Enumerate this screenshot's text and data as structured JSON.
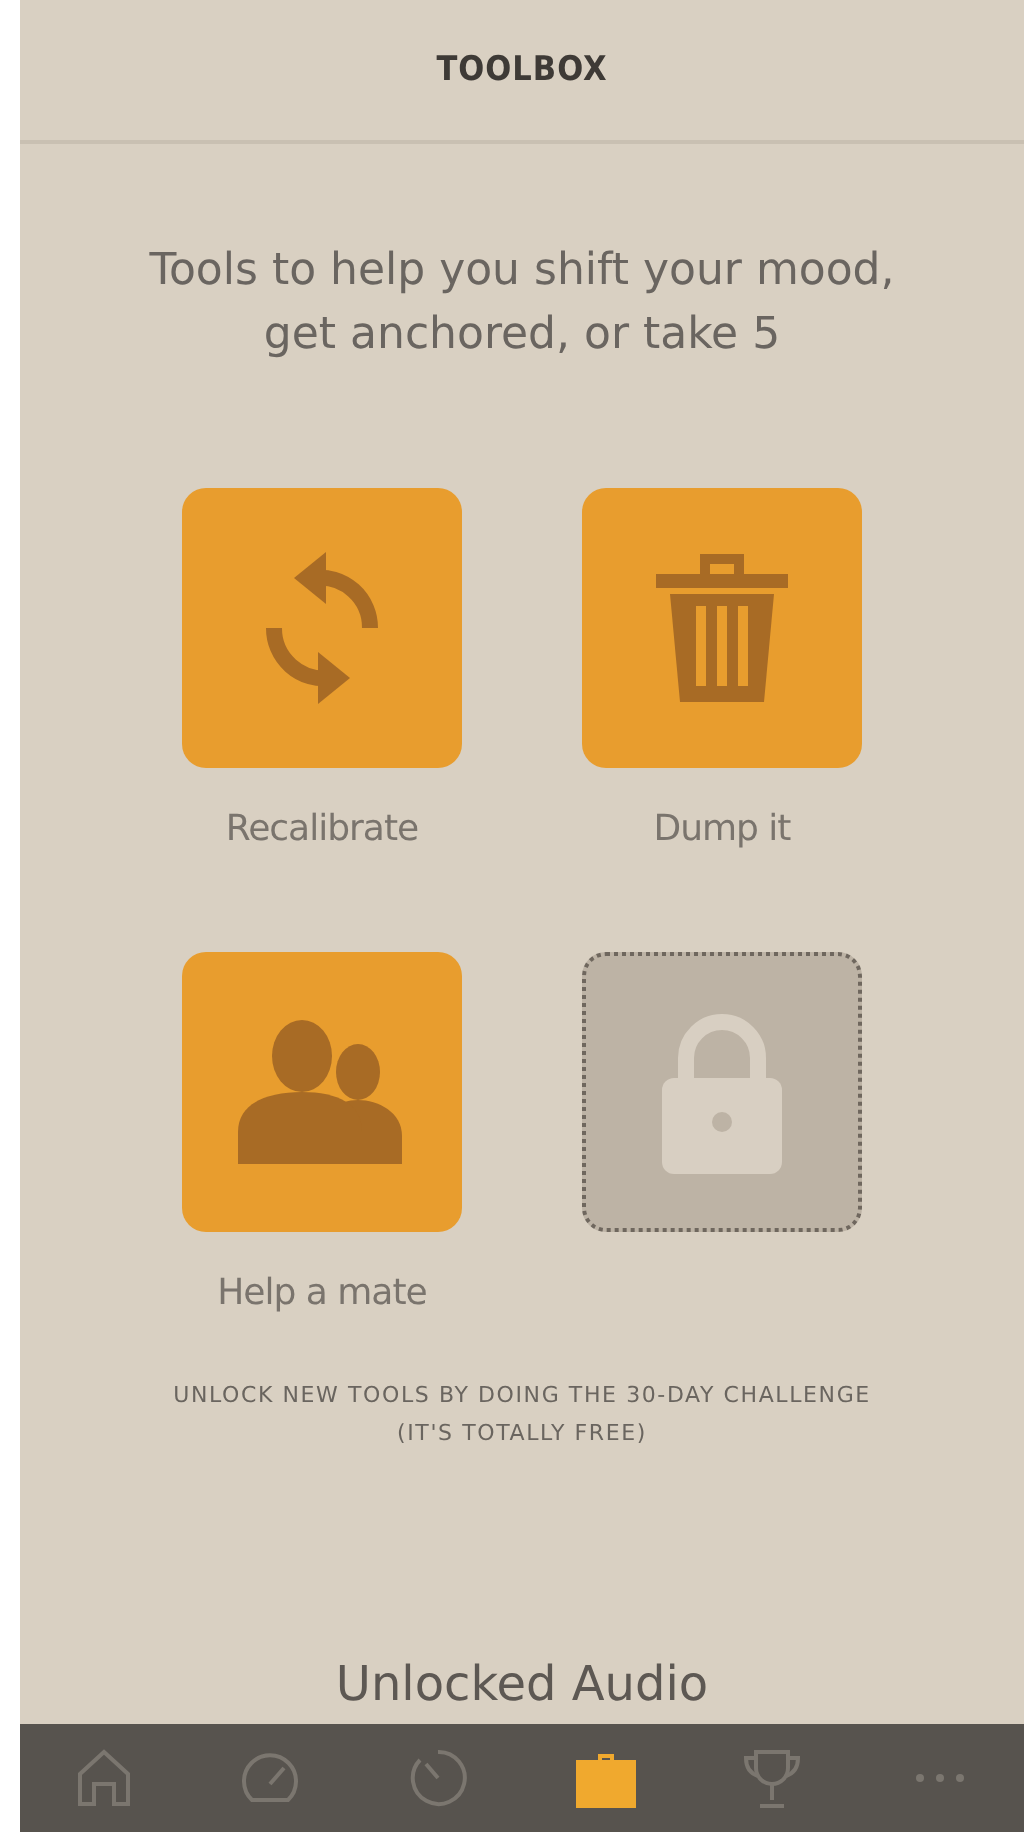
{
  "header": {
    "title": "TOOLBOX"
  },
  "intro": "Tools to help you shift your mood, get anchored, or take 5",
  "tools": [
    {
      "kind": "refresh",
      "label": "Recalibrate",
      "locked": false
    },
    {
      "kind": "trash",
      "label": "Dump it",
      "locked": false
    },
    {
      "kind": "people",
      "label": "Help a mate",
      "locked": false
    },
    {
      "kind": "lock",
      "locked": true
    }
  ],
  "unlock_note": "UNLOCK NEW TOOLS BY DOING THE 30-DAY CHALLENGE\n(IT'S TOTALLY FREE)",
  "section_title": "Unlocked Audio",
  "tab_bar": [
    {
      "kind": "home",
      "selected": false
    },
    {
      "kind": "gauge",
      "selected": false
    },
    {
      "kind": "timer",
      "selected": false
    },
    {
      "kind": "toolbox",
      "selected": true
    },
    {
      "kind": "trophy",
      "selected": false
    },
    {
      "kind": "more",
      "selected": false
    }
  ]
}
